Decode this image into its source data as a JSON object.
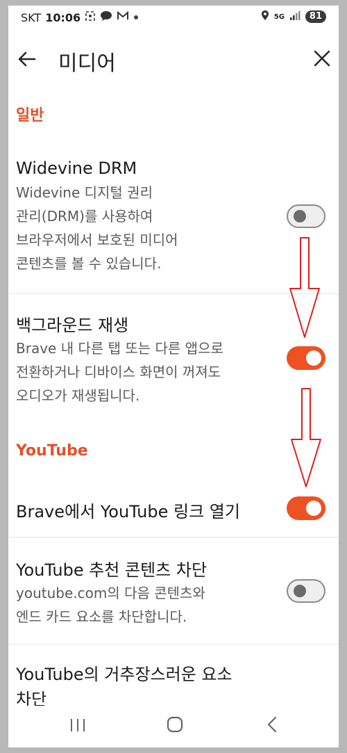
{
  "statusbar": {
    "carrier": "SKT",
    "time": "10:06",
    "network": "5G",
    "battery": "81"
  },
  "header": {
    "title": "미디어"
  },
  "sections": {
    "general": "일반",
    "youtube": "YouTube"
  },
  "items": {
    "widevine": {
      "title": "Widevine DRM",
      "desc_lines": [
        "Widevine 디지털 권리",
        "관리(DRM)를 사용하여",
        "브라우저에서 보호된 미디어",
        "콘텐츠를 볼 수 있습니다."
      ],
      "enabled": false
    },
    "background_play": {
      "title": "백그라운드 재생",
      "desc_lines": [
        "Brave 내 다른 탭 또는 다른 앱으로",
        "전환하거나 디바이스 화면이 꺼져도",
        "오디오가 재생됩니다."
      ],
      "enabled": true
    },
    "open_youtube": {
      "title": "Brave에서 YouTube 링크 열기",
      "enabled": true
    },
    "block_recommended": {
      "title": "YouTube 추천 콘텐츠 차단",
      "desc_lines": [
        "youtube.com의 다음 콘텐츠와",
        "엔드 카드 요소를 차단합니다."
      ],
      "enabled": false
    },
    "block_distracting": {
      "title_lines": [
        "YouTube의 거추장스러운 요소",
        "차단"
      ]
    }
  },
  "colors": {
    "accent": "#ee5122",
    "section_title": "#e2522b",
    "arrow": "#e02020"
  },
  "icons": [
    "back-arrow-icon",
    "close-icon",
    "recent-apps-icon",
    "home-icon",
    "back-nav-icon"
  ]
}
